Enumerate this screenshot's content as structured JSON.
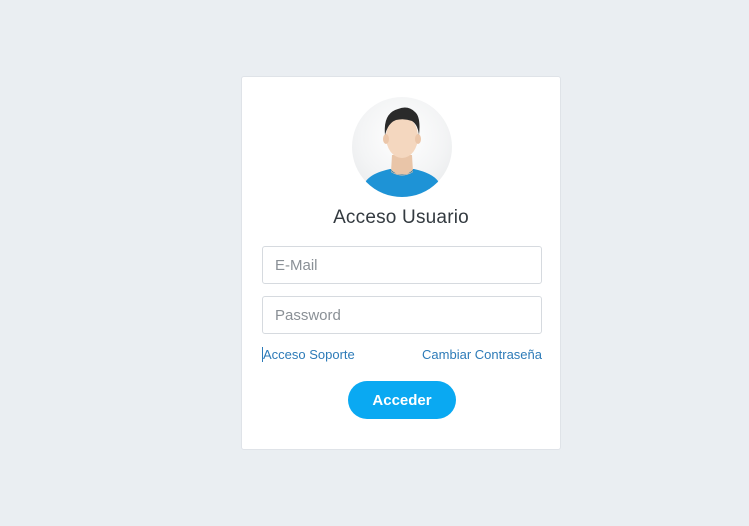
{
  "login": {
    "title": "Acceso Usuario",
    "email_placeholder": "E-Mail",
    "password_placeholder": "Password",
    "support_link": "Acceso Soporte",
    "change_password_link": "Cambiar Contraseña",
    "submit_label": "Acceder"
  },
  "icons": {
    "avatar": "user-avatar-icon"
  },
  "colors": {
    "background": "#eaeef2",
    "card": "#ffffff",
    "link": "#2d7bb8",
    "button": "#0aa9f2",
    "button_text": "#ffffff"
  }
}
